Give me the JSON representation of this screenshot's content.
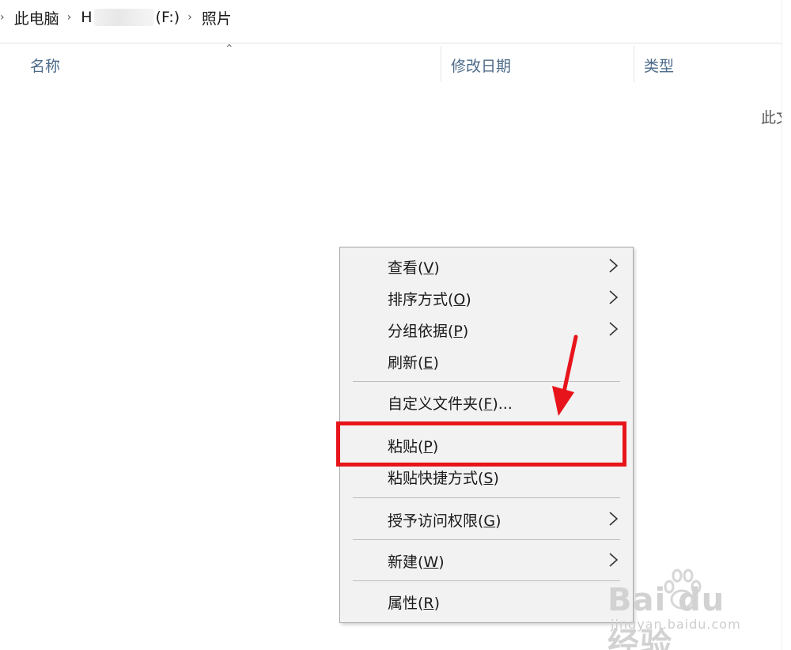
{
  "breadcrumb": {
    "items": [
      "此电脑",
      "H",
      "(F:)",
      "照片"
    ],
    "separator": "›"
  },
  "columns": {
    "name": "名称",
    "date": "修改日期",
    "type": "类型"
  },
  "empty_message": "此文件夹为空。",
  "context_menu": {
    "items": [
      {
        "label": "查看(",
        "key": "V",
        "suffix": ")",
        "has_submenu": true
      },
      {
        "label": "排序方式(",
        "key": "O",
        "suffix": ")",
        "has_submenu": true
      },
      {
        "label": "分组依据(",
        "key": "P",
        "suffix": ")",
        "has_submenu": true
      },
      {
        "label": "刷新(",
        "key": "E",
        "suffix": ")",
        "has_submenu": false
      },
      {
        "label": "自定义文件夹(",
        "key": "F",
        "suffix": ")...",
        "has_submenu": false
      },
      {
        "label": "粘贴(",
        "key": "P",
        "suffix": ")",
        "has_submenu": false,
        "highlighted": true
      },
      {
        "label": "粘贴快捷方式(",
        "key": "S",
        "suffix": ")",
        "has_submenu": false
      },
      {
        "label": "授予访问权限(",
        "key": "G",
        "suffix": ")",
        "has_submenu": true
      },
      {
        "label": "新建(",
        "key": "W",
        "suffix": ")",
        "has_submenu": true
      },
      {
        "label": "属性(",
        "key": "R",
        "suffix": ")",
        "has_submenu": false
      }
    ]
  },
  "annotation": {
    "highlight_color": "#e8141b",
    "arrow_color": "#e8141b",
    "target": "粘贴(P)"
  },
  "watermark": {
    "main": "Bai du 经验",
    "sub": "jingyan.baidu.com"
  }
}
